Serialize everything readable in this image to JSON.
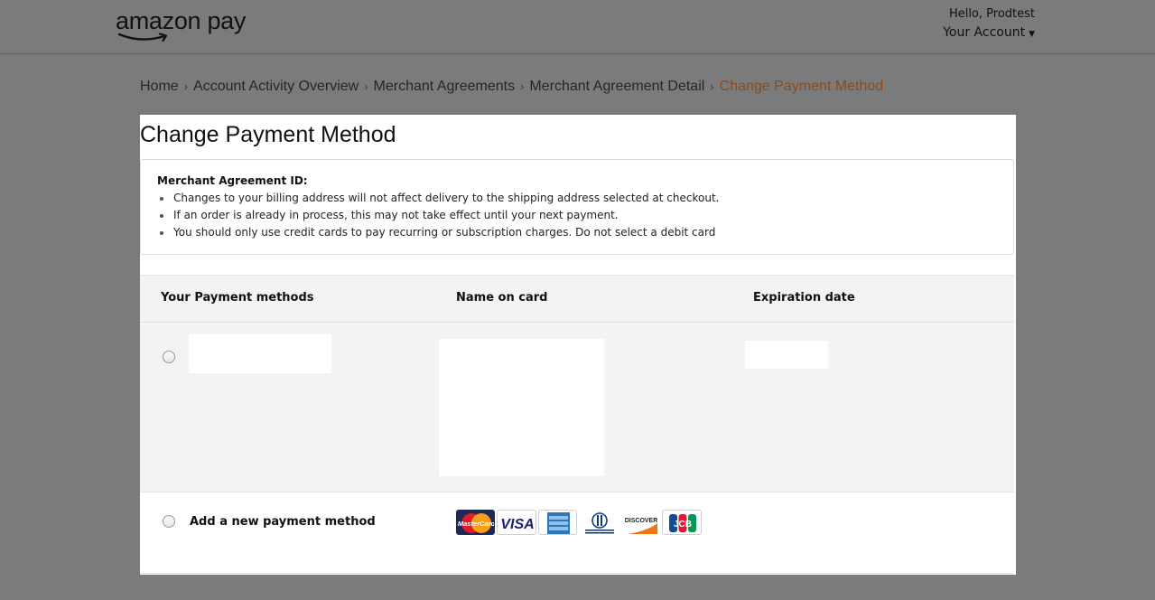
{
  "header": {
    "logo_text": "amazon pay",
    "greeting": "Hello, Prodtest",
    "account_label": "Your Account",
    "account_caret_icon": "caret-down-icon"
  },
  "breadcrumb": {
    "items": [
      "Home",
      "Account Activity Overview",
      "Merchant Agreements",
      "Merchant Agreement Detail"
    ],
    "current": "Change Payment Method",
    "separator_icon": "chevron-right-icon"
  },
  "page": {
    "title": "Change Payment Method"
  },
  "info": {
    "label": "Merchant Agreement ID:",
    "bullets": [
      "Changes to your billing address will not affect delivery to the shipping address selected at checkout.",
      "If an order is already in process, this may not take effect until your next payment.",
      "You should only use credit cards to pay recurring or subscription charges. Do not select a debit card"
    ]
  },
  "table": {
    "columns": [
      "Your Payment methods",
      "Name on card",
      "Expiration date"
    ]
  },
  "new_method": {
    "label": "Add a new payment method",
    "card_brands": [
      "MasterCard",
      "VISA",
      "American Express",
      "Diners Club International",
      "DISCOVER",
      "JCB"
    ]
  },
  "colors": {
    "background": "#7b7b7b",
    "panel": "#ffffff",
    "breadcrumb_current": "#8a4b1e",
    "logo_smile": "#e47911"
  }
}
